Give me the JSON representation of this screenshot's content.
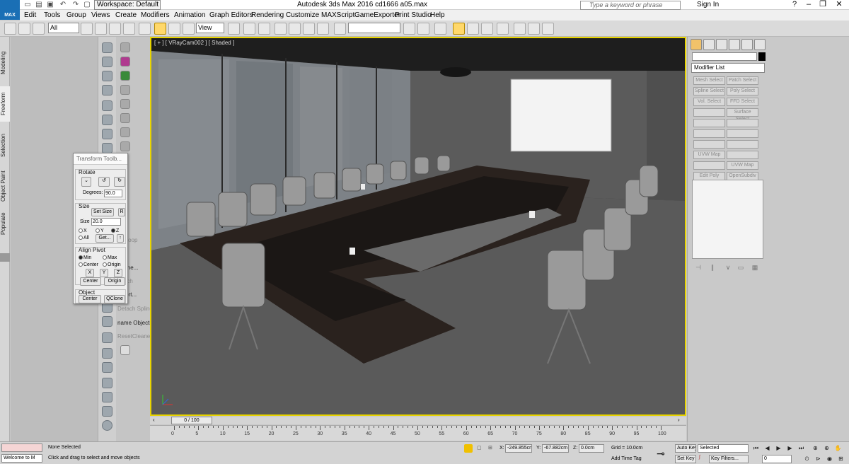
{
  "app": {
    "logo": "MAX",
    "workspace": "Workspace: Default",
    "title": "Autodesk 3ds Max 2016     cd1666 a05.max",
    "search_placeholder": "Type a keyword or phrase",
    "sign_in": "Sign In"
  },
  "menu": [
    "Edit",
    "Tools",
    "Group",
    "Views",
    "Create",
    "Modifiers",
    "Animation",
    "Graph Editors",
    "Rendering",
    "Customize",
    "MAXScript",
    "GameExporter",
    "Print Studio",
    "Help"
  ],
  "toolbar": {
    "selection_filter": "All",
    "ref_coord": "View",
    "named_sel": ""
  },
  "ribbon_tabs": [
    "Modeling",
    "Freeform",
    "Selection",
    "Object Paint",
    "Populate"
  ],
  "left_labels": {
    "loop": "...l Loop",
    "scene": "Scene...",
    "detach": "...tach",
    "import": "...port...",
    "detach_spline": "Detach Spline",
    "rename": "name Objects",
    "cleaner": "ResetCleaner"
  },
  "viewport": {
    "label": "[ + ] [ VRayCam002 ] [ Shaded ]"
  },
  "toolbox": {
    "title": "Transform Toolb...",
    "rotate": {
      "label": "Rotate",
      "degrees_label": "Degrees:",
      "degrees": "90.0"
    },
    "size": {
      "label": "Size",
      "set_size": "Set Size",
      "r": "R",
      "size_label": "Size",
      "size_value": "20.0",
      "x": "X",
      "y": "Y",
      "z": "Z",
      "all": "All",
      "get": "Get..."
    },
    "align": {
      "label": "Align Pivot",
      "min": "Min",
      "max": "Max",
      "center": "Center",
      "origin": "Origin",
      "x": "X",
      "y": "Y",
      "z": "Z",
      "center_btn": "Center",
      "origin_btn": "Origin"
    },
    "object": {
      "label": "Object",
      "center": "Center",
      "qclone": "QClone"
    }
  },
  "command_panel": {
    "modifier_list": "Modifier List",
    "buttons": [
      [
        "Mesh Select",
        "Patch Select"
      ],
      [
        "Spline Select",
        "Poly Select"
      ],
      [
        "Vol. Select",
        "FFD Select"
      ],
      [
        "",
        "Surface Select"
      ],
      [
        "",
        ""
      ],
      [
        "",
        ""
      ],
      [
        "",
        ""
      ],
      [
        "UVW Map",
        ""
      ],
      [
        "",
        "UVW Map"
      ],
      [
        "Edit Poly",
        "OpenSubdiv"
      ]
    ]
  },
  "timeline": {
    "frame": "0 / 100",
    "ticks": [
      "0",
      "5",
      "10",
      "15",
      "20",
      "25",
      "30",
      "35",
      "40",
      "45",
      "50",
      "55",
      "60",
      "65",
      "70",
      "75",
      "80",
      "85",
      "90",
      "95",
      "100"
    ]
  },
  "status": {
    "maxscript": "Welcome to M",
    "selection": "None Selected",
    "prompt": "Click and drag to select and move objects",
    "x_label": "X:",
    "x": "-249.855cn",
    "y_label": "Y:",
    "y": "-67.882cm",
    "z_label": "Z:",
    "z": "0.0cm",
    "grid": "Grid = 10.0cm",
    "add_time_tag": "Add Time Tag",
    "auto_key": "Auto Key",
    "set_key": "Set Key",
    "key_mode": "Selected",
    "key_filters": "Key Filters...",
    "frame": "0"
  }
}
